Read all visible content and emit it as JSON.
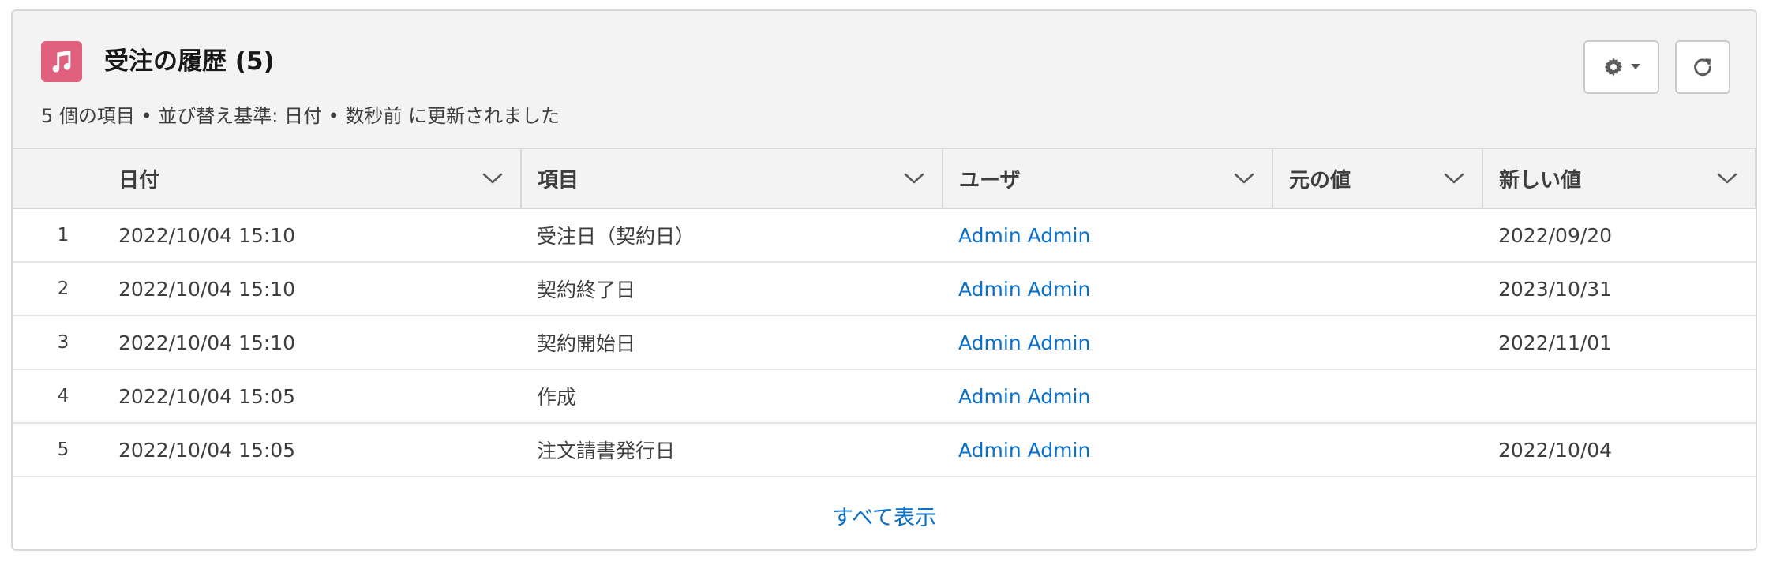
{
  "header": {
    "title": "受注の履歴 (5)",
    "subtitle": "5 個の項目 • 並び替え基準: 日付 • 数秒前 に更新されました",
    "icon": "music-note-icon",
    "icon_color": "#e0607e"
  },
  "toolbar": {
    "settings_icon": "gear-icon",
    "refresh_icon": "refresh-icon"
  },
  "table": {
    "columns": [
      "日付",
      "項目",
      "ユーザ",
      "元の値",
      "新しい値"
    ],
    "rows": [
      {
        "num": "1",
        "date": "2022/10/04 15:10",
        "field": "受注日（契約日）",
        "user": "Admin Admin",
        "old": "",
        "new": "2022/09/20"
      },
      {
        "num": "2",
        "date": "2022/10/04 15:10",
        "field": "契約終了日",
        "user": "Admin Admin",
        "old": "",
        "new": "2023/10/31"
      },
      {
        "num": "3",
        "date": "2022/10/04 15:10",
        "field": "契約開始日",
        "user": "Admin Admin",
        "old": "",
        "new": "2022/11/01"
      },
      {
        "num": "4",
        "date": "2022/10/04 15:05",
        "field": "作成",
        "user": "Admin Admin",
        "old": "",
        "new": ""
      },
      {
        "num": "5",
        "date": "2022/10/04 15:05",
        "field": "注文請書発行日",
        "user": "Admin Admin",
        "old": "",
        "new": "2022/10/04"
      }
    ]
  },
  "footer": {
    "view_all": "すべて表示"
  },
  "colors": {
    "link": "#0b70c9",
    "header_bg": "#f3f3f3",
    "border": "#d8d8d8"
  }
}
